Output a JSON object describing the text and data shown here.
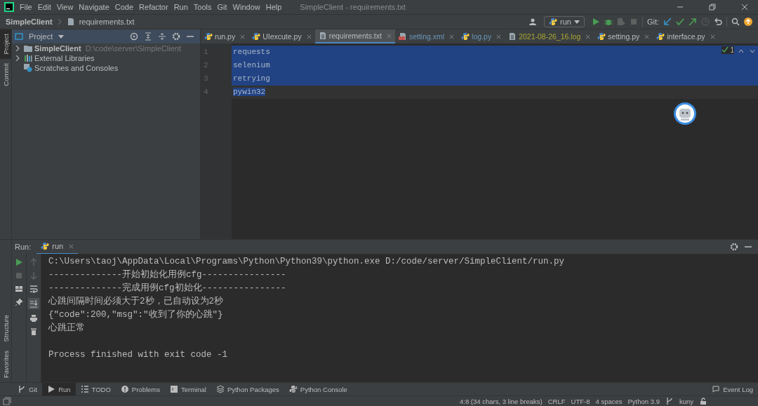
{
  "window": {
    "title": "SimpleClient - requirements.txt"
  },
  "menu": [
    "File",
    "Edit",
    "View",
    "Navigate",
    "Code",
    "Refactor",
    "Run",
    "Tools",
    "Git",
    "Window",
    "Help"
  ],
  "breadcrumb": [
    "SimpleClient",
    "requirements.txt"
  ],
  "toolbar": {
    "run_config": "run",
    "git_label": "Git:"
  },
  "left_stripe": {
    "top": [
      {
        "label": "Project",
        "selected": true
      },
      {
        "label": "Commit",
        "selected": false
      }
    ],
    "bottom": [
      {
        "label": "Structure",
        "selected": false
      },
      {
        "label": "Favorites",
        "selected": false
      }
    ]
  },
  "project_panel": {
    "title": "Project",
    "items": [
      {
        "name": "SimpleClient",
        "path": "D:\\code\\server\\SimpleClient",
        "kind": "folder",
        "expanded": false
      },
      {
        "name": "External Libraries",
        "kind": "library",
        "expanded": false
      },
      {
        "name": "Scratches and Consoles",
        "kind": "scratch"
      }
    ]
  },
  "editor_tabs": [
    {
      "label": "run.py",
      "kind": "python",
      "color": "#bbbbbb",
      "selected": false
    },
    {
      "label": "UIexcute.py",
      "kind": "python",
      "color": "#bbbbbb",
      "selected": false
    },
    {
      "label": "requirements.txt",
      "kind": "text",
      "color": "#bbbbbb",
      "selected": true
    },
    {
      "label": "setting.xml",
      "kind": "xml",
      "color": "#6897bb",
      "selected": false
    },
    {
      "label": "log.py",
      "kind": "python",
      "color": "#6897bb",
      "selected": false
    },
    {
      "label": "2021-08-26_16.log",
      "kind": "text",
      "color": "#a8a832",
      "selected": false
    },
    {
      "label": "setting.py",
      "kind": "python",
      "color": "#bbbbbb",
      "selected": false
    },
    {
      "label": "interface.py",
      "kind": "python",
      "color": "#bbbbbb",
      "selected": false
    }
  ],
  "editor": {
    "inspection_count": "1",
    "lines": [
      {
        "number": "1",
        "text": "requests",
        "selected": true
      },
      {
        "number": "2",
        "text": "selenium",
        "selected": true
      },
      {
        "number": "3",
        "text": "retrying",
        "selected": true
      },
      {
        "number": "4",
        "text": "pywin32",
        "selected": true
      }
    ]
  },
  "run_panel": {
    "label": "Run:",
    "tab": "run",
    "console": [
      "C:\\Users\\taoj\\AppData\\Local\\Programs\\Python\\Python39\\python.exe D:/code/server/SimpleClient/run.py",
      "--------------开始初始化用例cfg----------------",
      "--------------完成用例cfg初始化----------------",
      "心跳间隔时间必须大于2秒，已自动设为2秒",
      "{\"code\":200,\"msg\":\"收到了你的心跳\"}",
      "心跳正常",
      "Process finished with exit code -1"
    ]
  },
  "tool_windows": [
    {
      "label": "Git",
      "kind": "git",
      "selected": false
    },
    {
      "label": "Run",
      "kind": "run",
      "selected": true
    },
    {
      "label": "TODO",
      "kind": "todo",
      "selected": false
    },
    {
      "label": "Problems",
      "kind": "problems",
      "selected": false
    },
    {
      "label": "Terminal",
      "kind": "terminal",
      "selected": false
    },
    {
      "label": "Python Packages",
      "kind": "packages",
      "selected": false
    },
    {
      "label": "Python Console",
      "kind": "console",
      "selected": false
    }
  ],
  "event_log": "Event Log",
  "status_bar": [
    "4:8 (34 chars, 3 line breaks)",
    "CRLF",
    "UTF-8",
    "4 spaces",
    "Python 3.9",
    "kuny"
  ]
}
